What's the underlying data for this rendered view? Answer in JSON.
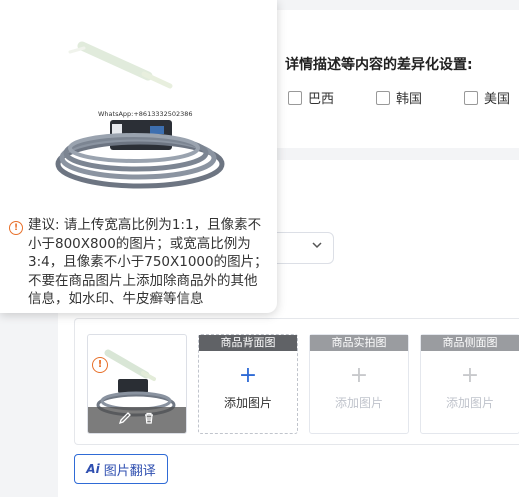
{
  "differentiation": {
    "title": "详情描述等内容的差异化设置:",
    "countries": [
      "巴西",
      "韩国",
      "美国"
    ]
  },
  "popover": {
    "watermark": "WhatsApp:+8613332502386",
    "advice": "建议: 请上传宽高比例为1:1，且像素不小于800X800的图片；或宽高比例为3:4，且像素不小于750X1000的图片；不要在商品图片上添加除商品外的其他信息，如水印、牛皮癣等信息"
  },
  "image_slots": [
    {
      "header": "商品背面图",
      "label": "添加图片",
      "enabled": true
    },
    {
      "header": "商品实拍图",
      "label": "添加图片",
      "enabled": false
    },
    {
      "header": "商品侧面图",
      "label": "添加图片",
      "enabled": false
    }
  ],
  "translate": {
    "icon": "ai-translate-icon",
    "label": "图片翻译",
    "ai_text": "Ai"
  },
  "colors": {
    "accent": "#2f6bd6",
    "warning": "#e8702a"
  }
}
